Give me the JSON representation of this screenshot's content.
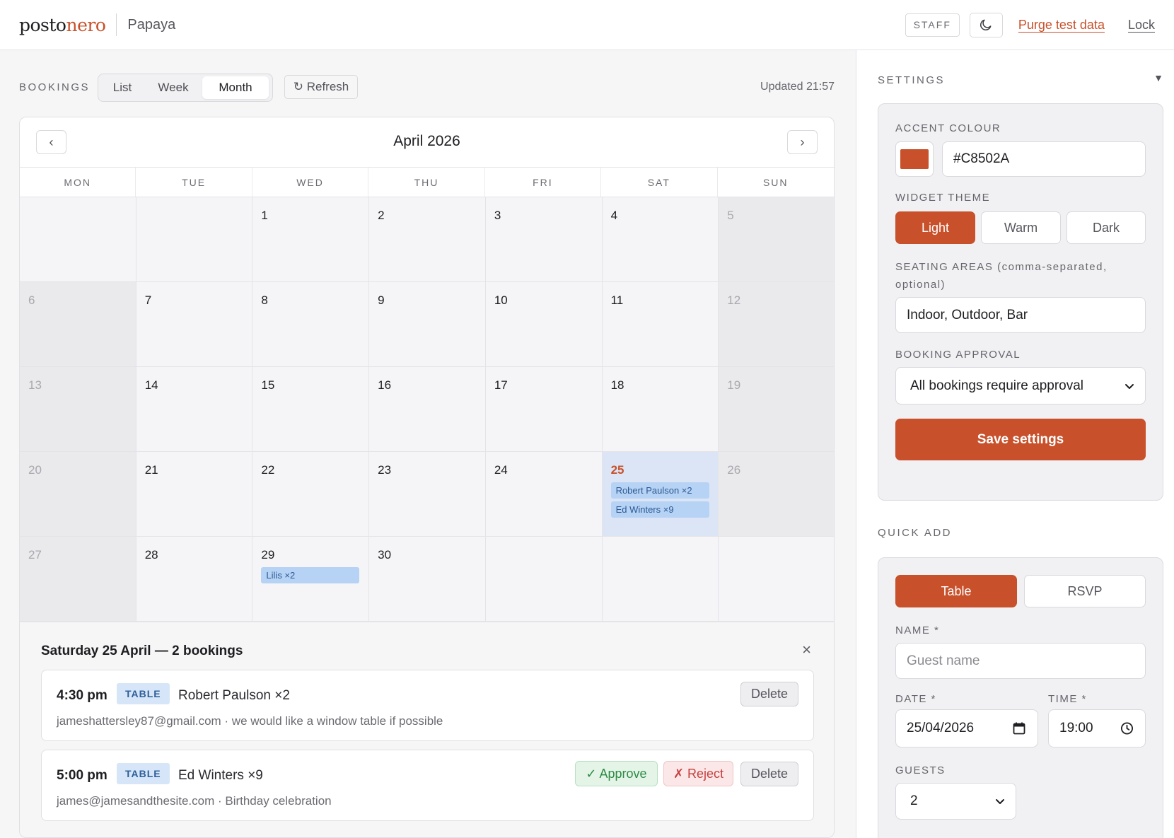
{
  "header": {
    "logo_part1": "posto",
    "logo_part2": "nero",
    "venue": "Papaya",
    "staff_badge": "STAFF",
    "purge_link": "Purge test data",
    "lock_link": "Lock"
  },
  "toolbar": {
    "section_label": "BOOKINGS",
    "views": [
      "List",
      "Week",
      "Month"
    ],
    "active_view": "Month",
    "refresh_label": "↻ Refresh",
    "updated_text": "Updated 21:57"
  },
  "calendar": {
    "prev_label": "‹",
    "next_label": "›",
    "month_title": "April 2026",
    "weekdays": [
      "MON",
      "TUE",
      "WED",
      "THU",
      "FRI",
      "SAT",
      "SUN"
    ],
    "weeks": [
      [
        "",
        "",
        "1",
        "2",
        "3",
        "4",
        "5"
      ],
      [
        "6",
        "7",
        "8",
        "9",
        "10",
        "11",
        "12"
      ],
      [
        "13",
        "14",
        "15",
        "16",
        "17",
        "18",
        "19"
      ],
      [
        "20",
        "21",
        "22",
        "23",
        "24",
        "25",
        "26"
      ],
      [
        "27",
        "28",
        "29",
        "30",
        "",
        "",
        ""
      ]
    ],
    "today": "25",
    "events": {
      "25": [
        "Robert Paulson ×2",
        "Ed Winters ×9"
      ],
      "29": [
        "Lilis ×2"
      ]
    }
  },
  "detail": {
    "title": "Saturday 25 April — 2 bookings",
    "close_label": "×",
    "approve_label": "✓ Approve",
    "reject_label": "✗ Reject",
    "delete_label": "Delete",
    "bookings": [
      {
        "time": "4:30 pm",
        "type": "TABLE",
        "name": "Robert Paulson ×2",
        "details": "jameshattersley87@gmail.com · we would like a window table if possible"
      },
      {
        "time": "5:00 pm",
        "type": "TABLE",
        "name": "Ed Winters ×9",
        "details": "james@jamesandthesite.com · Birthday celebration"
      }
    ]
  },
  "settings": {
    "section_label": "SETTINGS",
    "collapse_label": "▼",
    "accent_label": "ACCENT COLOUR",
    "accent_value": "#C8502A",
    "theme_label": "WIDGET THEME",
    "themes": [
      "Light",
      "Warm",
      "Dark"
    ],
    "active_theme": "Light",
    "seating_label": "SEATING AREAS (comma-separated, optional)",
    "seating_value": "Indoor, Outdoor, Bar",
    "approval_label": "BOOKING APPROVAL",
    "approval_value": "All bookings require approval",
    "save_label": "Save settings"
  },
  "quick_add": {
    "section_label": "QUICK ADD",
    "modes": [
      "Table",
      "RSVP"
    ],
    "active_mode": "Table",
    "name_label": "NAME *",
    "name_placeholder": "Guest name",
    "date_label": "DATE *",
    "date_value": "25/04/2026",
    "time_label": "TIME *",
    "time_value": "19:00",
    "guests_label": "GUESTS",
    "guests_value": "2"
  },
  "colors": {
    "accent": "#C8502A",
    "event_chip": "#b6d2f4",
    "today_cell": "#dbe5f5",
    "approve_green": "#2d8a45",
    "reject_red": "#c63f3f"
  },
  "icons": {
    "theme_toggle": "moon-icon",
    "calendar_picker": "calendar-icon",
    "time_picker": "clock-icon",
    "select_arrow": "chevron-down-icon"
  }
}
